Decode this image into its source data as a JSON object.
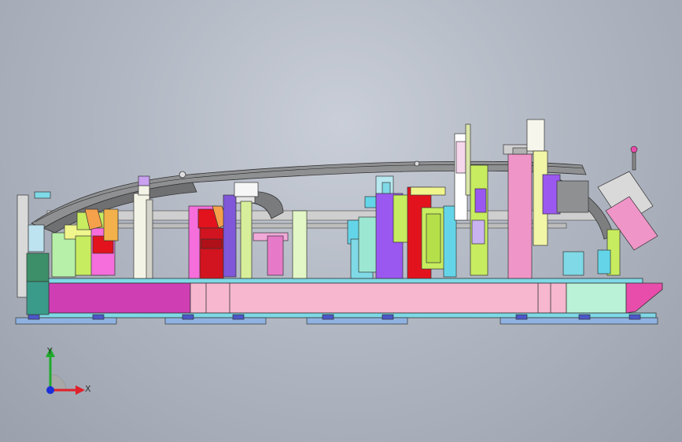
{
  "viewport": {
    "background_top": "#c9ced8",
    "background_bottom": "#9aa1ad"
  },
  "triad": {
    "x_label": "X",
    "y_label": "Y",
    "x_color": "#e0202a",
    "y_color": "#1faa2c",
    "z_color": "#1a2fd8",
    "quadrant_color": "#a8a8a8"
  },
  "palette": {
    "base_pink": "#f6b7cf",
    "base_magenta": "#cf3fb3",
    "base_mint": "#b9f2d6",
    "rail_cyan": "#7fd9e6",
    "feet_blue": "#8fb2e0",
    "frame_grey": "#cfcfcf",
    "dark_green": "#3d8f6a",
    "red": "#e3131d",
    "yellow_green": "#c7ec5f",
    "violet": "#9a58f0",
    "light_yellow": "#f1f5a6",
    "pink": "#f095c8",
    "cyan": "#64d5e8"
  }
}
